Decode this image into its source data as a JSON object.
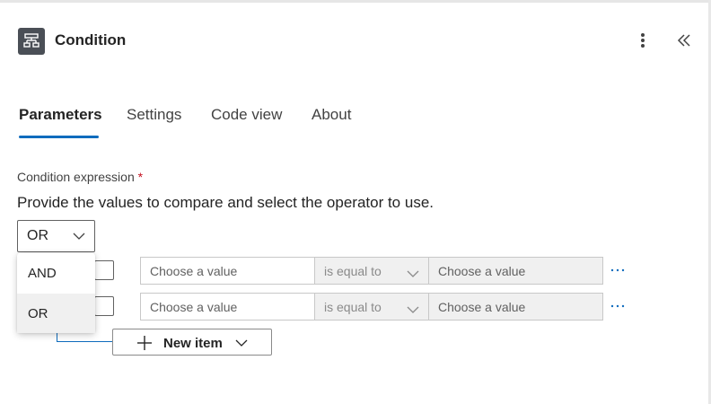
{
  "header": {
    "title": "Condition",
    "icon": "condition-icon",
    "icon_bg": "#4a4f56"
  },
  "tabs": [
    {
      "label": "Parameters",
      "active": true
    },
    {
      "label": "Settings",
      "active": false
    },
    {
      "label": "Code view",
      "active": false
    },
    {
      "label": "About",
      "active": false
    }
  ],
  "condition": {
    "label": "Condition expression",
    "required_mark": "*",
    "description": "Provide the values to compare and select the operator to use.",
    "group_operator": "OR",
    "operator_options": [
      {
        "label": "AND",
        "selected": false
      },
      {
        "label": "OR",
        "selected": true
      }
    ],
    "rows": [
      {
        "left_placeholder": "Choose a value",
        "operator": "is equal to",
        "right_placeholder": "Choose a value",
        "more": "···"
      },
      {
        "left_placeholder": "Choose a value",
        "operator": "is equal to",
        "right_placeholder": "Choose a value",
        "more": "···"
      }
    ],
    "new_item_label": "New item"
  },
  "colors": {
    "accent": "#0f6cbd",
    "required": "#c50f1f"
  }
}
